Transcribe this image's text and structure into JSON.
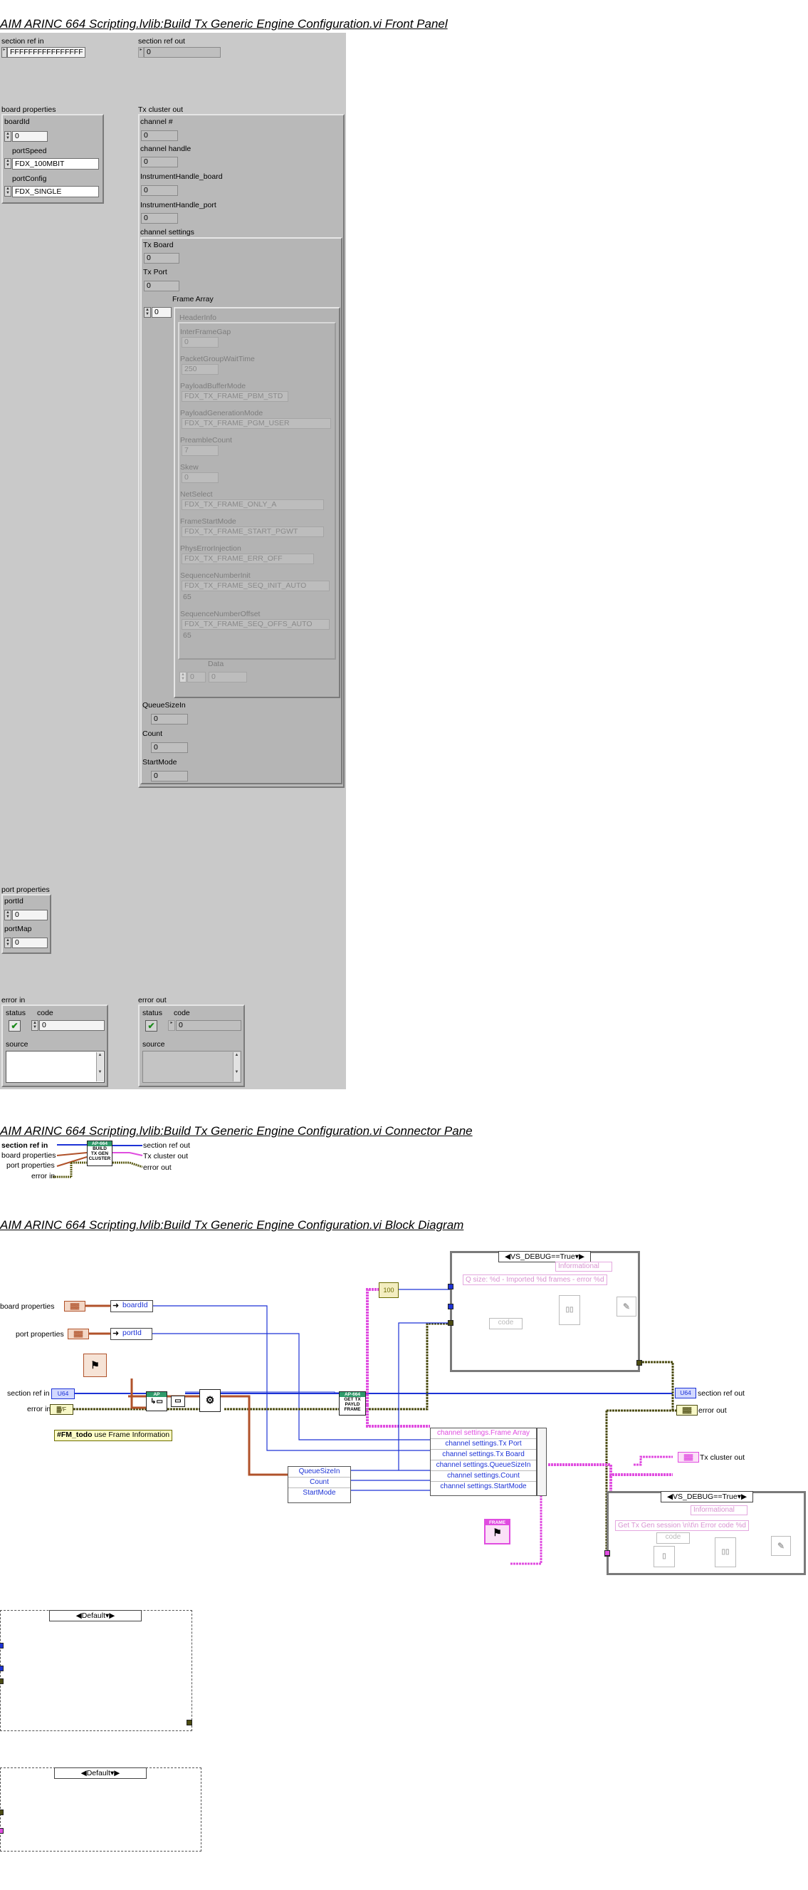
{
  "titles": {
    "front_panel": "AIM ARINC 664 Scripting.lvlib:Build Tx Generic Engine Configuration.vi Front Panel",
    "connector_pane": "AIM ARINC 664 Scripting.lvlib:Build Tx Generic Engine Configuration.vi Connector Pane",
    "block_diagram": "AIM ARINC 664 Scripting.lvlib:Build Tx Generic Engine Configuration.vi Block Diagram"
  },
  "front_panel": {
    "section_ref_in": {
      "label": "section ref in",
      "value": "FFFFFFFFFFFFFFFF"
    },
    "section_ref_out": {
      "label": "section ref out",
      "value": "0"
    },
    "board_properties": {
      "label": "board properties",
      "boardId": {
        "label": "boardId",
        "value": "0"
      },
      "portSpeed": {
        "label": "portSpeed",
        "value": "FDX_100MBIT"
      },
      "portConfig": {
        "label": "portConfig",
        "value": "FDX_SINGLE"
      }
    },
    "tx_cluster_out": {
      "label": "Tx cluster out",
      "channel_num": {
        "label": "channel #",
        "value": "0"
      },
      "channel_handle": {
        "label": "channel handle",
        "value": "0"
      },
      "instrument_board": {
        "label": "InstrumentHandle_board",
        "value": "0"
      },
      "instrument_port": {
        "label": "InstrumentHandle_port",
        "value": "0"
      },
      "channel_settings": {
        "label": "channel settings",
        "tx_board": {
          "label": "Tx Board",
          "value": "0"
        },
        "tx_port": {
          "label": "Tx Port",
          "value": "0"
        },
        "frame_array": {
          "label": "Frame Array",
          "index": "0",
          "header_info": {
            "label": "HeaderInfo",
            "fields": [
              {
                "label": "InterFrameGap",
                "value": "0"
              },
              {
                "label": "PacketGroupWaitTime",
                "value": "250"
              },
              {
                "label": "PayloadBufferMode",
                "value": "FDX_TX_FRAME_PBM_STD"
              },
              {
                "label": "PayloadGenerationMode",
                "value": "FDX_TX_FRAME_PGM_USER"
              },
              {
                "label": "PreambleCount",
                "value": "7"
              },
              {
                "label": "Skew",
                "value": "0"
              },
              {
                "label": "NetSelect",
                "value": "FDX_TX_FRAME_ONLY_A"
              },
              {
                "label": "FrameStartMode",
                "value": "FDX_TX_FRAME_START_PGWT"
              },
              {
                "label": "PhysErrorInjection",
                "value": "FDX_TX_FRAME_ERR_OFF"
              },
              {
                "label": "SequenceNumberInit",
                "value": "FDX_TX_FRAME_SEQ_INIT_AUTO"
              },
              {
                "label": "",
                "value": "65"
              },
              {
                "label": "SequenceNumberOffset",
                "value": "FDX_TX_FRAME_SEQ_OFFS_AUTO"
              },
              {
                "label": "",
                "value": "65"
              }
            ]
          },
          "data": {
            "label": "Data",
            "index": "0",
            "value": "0"
          }
        },
        "queue_size_in": {
          "label": "QueueSizeIn",
          "value": "0"
        },
        "count": {
          "label": "Count",
          "value": "0"
        },
        "start_mode": {
          "label": "StartMode",
          "value": "0"
        }
      }
    },
    "port_properties": {
      "label": "port properties",
      "portId": {
        "label": "portId",
        "value": "0"
      },
      "portMap": {
        "label": "portMap",
        "value": "0"
      }
    },
    "error_in": {
      "label": "error in",
      "status": "status",
      "code_label": "code",
      "code": "0",
      "source": "source"
    },
    "error_out": {
      "label": "error out",
      "status": "status",
      "code_label": "code",
      "code": "0",
      "source": "source"
    }
  },
  "connector_pane": {
    "left": [
      "section ref in",
      "board properties",
      "port properties",
      "error in"
    ],
    "right": [
      "section ref out",
      "Tx cluster out",
      "error out"
    ],
    "icon_text": [
      "AP-664",
      "BUILD",
      "TX GEN",
      "CLUSTER"
    ]
  },
  "block_diagram": {
    "terminals_left": [
      "board properties",
      "port properties",
      "section ref in",
      "error in"
    ],
    "terminals_right": [
      "section ref out",
      "error out",
      "Tx cluster out"
    ],
    "term_codes": {
      "cluster": "▓▓",
      "u32": "U64",
      "err": "▓▓",
      "err_in": "▓/F",
      "out_ref": "U64",
      "tx": "▓▓"
    },
    "unbundle_board": "boardId",
    "unbundle_port": "portId",
    "unbundle_sizes": [
      "QueueSizeIn",
      "Count",
      "StartMode"
    ],
    "bundle_fields": [
      "channel settings.Frame Array",
      "channel settings.Tx Port",
      "channel settings.Tx Board",
      "channel settings.QueueSizeIn",
      "channel settings.Count",
      "channel settings.StartMode"
    ],
    "todo_note_tag": "#FM_todo",
    "todo_note_text": " use Frame Information",
    "payload_vi_text": [
      "AP-664",
      "GET TX",
      "PAYLD",
      "FRAME"
    ],
    "debug_case_1": {
      "selector": "VS_DEBUG==True",
      "level": "Informational",
      "format": "Q size: %d - Imported %d frames - error %d",
      "code_label": "code"
    },
    "debug_case_2": {
      "selector": "VS_DEBUG==True",
      "level": "Informational",
      "format": "Get Tx Gen session \\n\\t\\n Error code %d",
      "code_label": "code"
    },
    "default_case_1": {
      "selector": "Default"
    },
    "default_case_2": {
      "selector": "Default"
    },
    "frame_const": "FRAME",
    "array_const": "100"
  }
}
